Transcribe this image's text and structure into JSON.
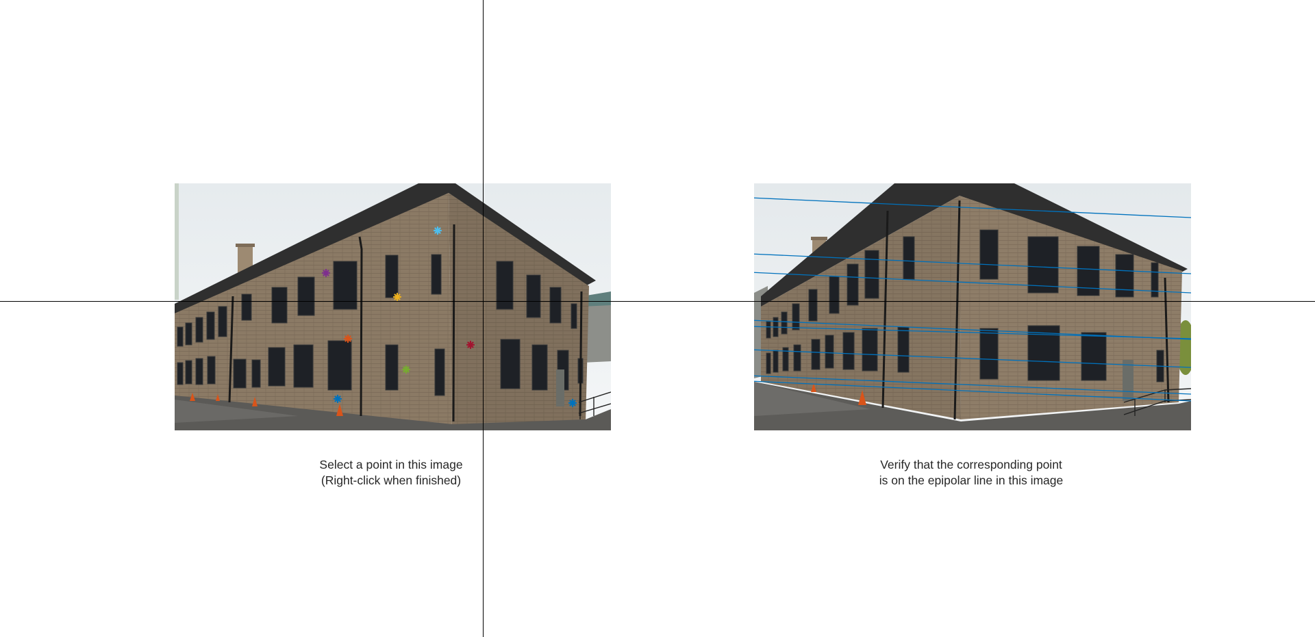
{
  "left_caption": {
    "line1": "Select a point in this image",
    "line2": "(Right-click when finished)"
  },
  "right_caption": {
    "line1": "Verify that the corresponding point",
    "line2": "is on the epipolar line in this image"
  },
  "left_image": {
    "subject": "two-storey tan brick building, corner view, windows, drain pipes, traffic cones, overcast sky",
    "selected_points": [
      {
        "color": "#4DBEEE"
      },
      {
        "color": "#7E2F8E"
      },
      {
        "color": "#EDB120"
      },
      {
        "color": "#D95319"
      },
      {
        "color": "#A2142F"
      },
      {
        "color": "#77AC30"
      },
      {
        "color": "#0072BD"
      },
      {
        "color": "#0072BD"
      }
    ]
  },
  "right_image": {
    "subject": "same building viewed from the other corner, with blue epipolar lines overlaid",
    "epipolar_line_color": "#0072BD",
    "epipolar_line_count": 8
  },
  "crosshair_color": "#000000"
}
